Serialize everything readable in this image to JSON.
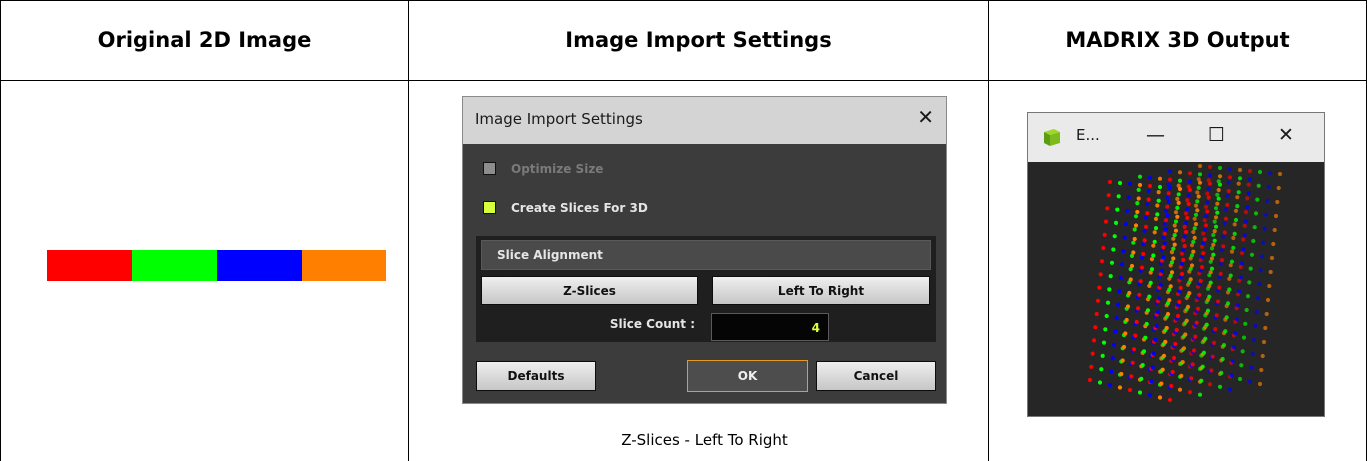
{
  "headers": {
    "col1": "Original 2D Image",
    "col2": "Image Import Settings",
    "col3": "MADRIX 3D Output"
  },
  "strip_colors": [
    "#ff0000",
    "#00ff00",
    "#0000ff",
    "#ff8000"
  ],
  "dialog": {
    "title": "Image Import Settings",
    "close_glyph": "✕",
    "optimize_size": {
      "label": "Optimize Size",
      "checked": false,
      "enabled": false
    },
    "create_slices": {
      "label": "Create Slices For 3D",
      "checked": true,
      "enabled": true
    },
    "section_title": "Slice Alignment",
    "slice_mode_button": "Z-Slices",
    "direction_button": "Left To Right",
    "slice_count_label": "Slice Count :",
    "slice_count_value": "4",
    "defaults_button": "Defaults",
    "ok_button": "OK",
    "cancel_button": "Cancel"
  },
  "caption": "Z-Slices - Left To Right",
  "output_window": {
    "title": "E...",
    "minimize_glyph": "—",
    "maximize_glyph": "☐",
    "close_glyph": "✕",
    "icon": "madrix-cube-icon"
  },
  "colors": {
    "accent_ok": "#e69a24",
    "checkbox_on": "#d8ff3c",
    "dialog_bg": "#3c3c3c"
  }
}
